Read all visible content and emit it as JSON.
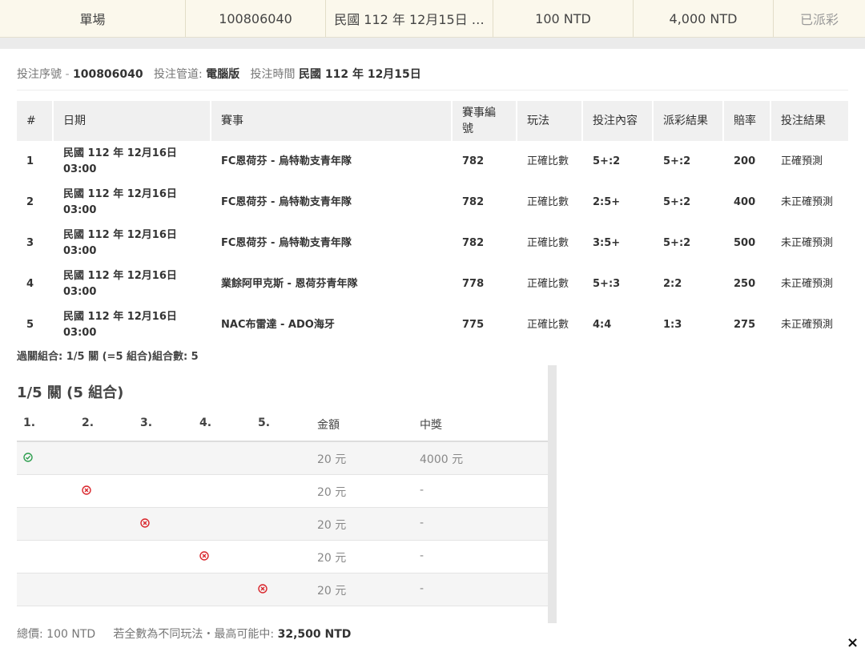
{
  "top_bar": {
    "type": "單場",
    "bet_id": "100806040",
    "date": "民國 112 年 12月15日 …",
    "stake": "100 NTD",
    "payout": "4,000 NTD",
    "status": "已派彩"
  },
  "meta": {
    "serial_label": "投注序號",
    "serial_value": "100806040",
    "channel_label": "投注管道:",
    "channel_value": "電腦版",
    "time_label": "投注時間",
    "time_value": "民國 112 年 12月15日"
  },
  "table": {
    "headers": [
      "#",
      "日期",
      "賽事",
      "賽事編號",
      "玩法",
      "投注內容",
      "派彩結果",
      "賠率",
      "投注結果"
    ],
    "rows": [
      {
        "no": "1",
        "date": "民國 112 年 12月16日",
        "time": "03:00",
        "match": "FC恩荷芬 - 烏特勒支青年隊",
        "match_no": "782",
        "play": "正確比數",
        "bet": "5+:2",
        "result": "5+:2",
        "odds": "200",
        "outcome": "正確預測"
      },
      {
        "no": "2",
        "date": "民國 112 年 12月16日",
        "time": "03:00",
        "match": "FC恩荷芬 - 烏特勒支青年隊",
        "match_no": "782",
        "play": "正確比數",
        "bet": "2:5+",
        "result": "5+:2",
        "odds": "400",
        "outcome": "未正確預測"
      },
      {
        "no": "3",
        "date": "民國 112 年 12月16日",
        "time": "03:00",
        "match": "FC恩荷芬 - 烏特勒支青年隊",
        "match_no": "782",
        "play": "正確比數",
        "bet": "3:5+",
        "result": "5+:2",
        "odds": "500",
        "outcome": "未正確預測"
      },
      {
        "no": "4",
        "date": "民國 112 年 12月16日",
        "time": "03:00",
        "match": "業餘阿甲克斯 - 恩荷芬青年隊",
        "match_no": "778",
        "play": "正確比數",
        "bet": "5+:3",
        "result": "2:2",
        "odds": "250",
        "outcome": "未正確預測"
      },
      {
        "no": "5",
        "date": "民國 112 年 12月16日",
        "time": "03:00",
        "match": "NAC布雷達 - ADO海牙",
        "match_no": "775",
        "play": "正確比數",
        "bet": "4:4",
        "result": "1:3",
        "odds": "275",
        "outcome": "未正確預測"
      }
    ]
  },
  "summary": "過關組合: 1/5 關 (=5 組合)組合數: 5",
  "combos": {
    "title": "1/5 關 (5 組合)",
    "headers": [
      "1.",
      "2.",
      "3.",
      "4.",
      "5.",
      "金額",
      "中獎"
    ],
    "rows": [
      {
        "col": 1,
        "icon": "check-circle-icon",
        "amount": "20 元",
        "win": "4000 元"
      },
      {
        "col": 2,
        "icon": "x-circle-icon",
        "amount": "20 元",
        "win": "-"
      },
      {
        "col": 3,
        "icon": "x-circle-icon",
        "amount": "20 元",
        "win": "-"
      },
      {
        "col": 4,
        "icon": "x-circle-icon",
        "amount": "20 元",
        "win": "-"
      },
      {
        "col": 5,
        "icon": "x-circle-icon",
        "amount": "20 元",
        "win": "-"
      }
    ]
  },
  "footer": {
    "total_label": "總價:",
    "total_value": "100 NTD",
    "max_label": "若全數為不同玩法・最高可能中:",
    "max_value": "32,500 NTD"
  },
  "close_icon": "×",
  "colors": {
    "win": "#2e9e4f",
    "lose": "#d9262c",
    "topbar": "#fbf8ec"
  }
}
